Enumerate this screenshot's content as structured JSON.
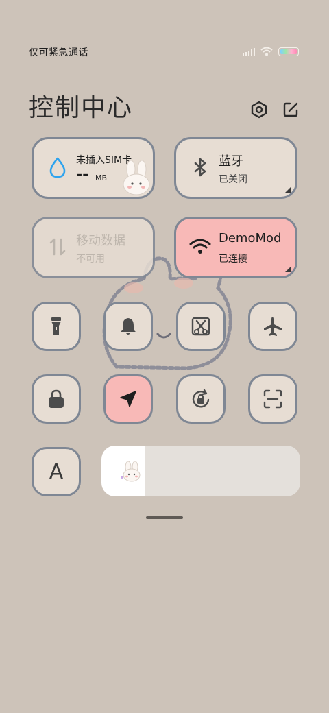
{
  "status": {
    "left_text": "仅可紧急通话"
  },
  "header": {
    "title": "控制中心",
    "settings_icon": "gear-icon",
    "edit_icon": "edit-icon"
  },
  "tiles": {
    "mobile_data_usage": {
      "title": "未插入SIM卡",
      "value": "--",
      "unit": "MB",
      "icon": "water-drop-icon"
    },
    "bluetooth": {
      "title": "蓝牙",
      "status": "已关闭",
      "icon": "bluetooth-icon"
    },
    "mobile_data": {
      "title": "移动数据",
      "status": "不可用",
      "icon": "data-arrows-icon"
    },
    "wifi": {
      "title": "DemoMod",
      "status": "已连接",
      "icon": "wifi-icon"
    }
  },
  "toggles_row1": [
    "flashlight-icon",
    "bell-icon",
    "screenshot-icon",
    "airplane-icon"
  ],
  "toggles_row2": [
    "lock-icon",
    "location-arrow-icon",
    "rotation-lock-icon",
    "scan-icon"
  ],
  "font_button": {
    "label": "A"
  },
  "brightness": {
    "level": 0.22
  },
  "colors": {
    "background": "#cdc3b9",
    "tile": "#e7ddd3",
    "active": "#f8b9b7",
    "border": "#7f8794"
  }
}
